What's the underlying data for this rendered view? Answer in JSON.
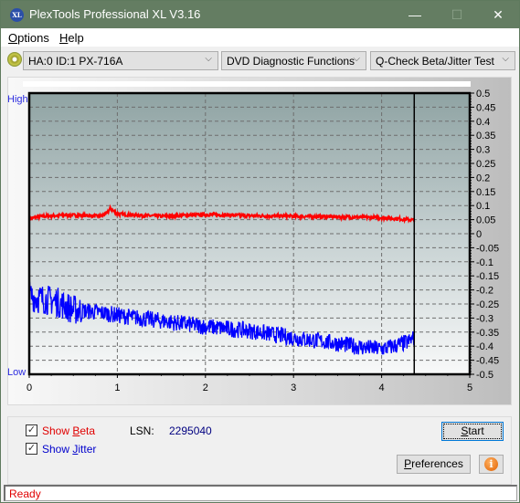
{
  "window": {
    "title": "PlexTools Professional XL V3.16",
    "app_icon": "XL",
    "minimize_icon": "—",
    "maximize_icon": "☐",
    "close_icon": "✕"
  },
  "menu": {
    "items": [
      {
        "label": "Options",
        "mnemonic": "O",
        "rest": "ptions"
      },
      {
        "label": "Help",
        "mnemonic": "H",
        "rest": "elp"
      }
    ]
  },
  "toolbar": {
    "drive_select": "HA:0 ID:1  PX-716A",
    "function_select": "DVD Diagnostic Functions",
    "test_select": "Q-Check Beta/Jitter Test",
    "chevron": "⌵"
  },
  "chart_data": {
    "type": "line",
    "title": "",
    "xlabel": "",
    "ylabel": "",
    "xlim": [
      0,
      5
    ],
    "ylim": [
      -0.5,
      0.5
    ],
    "x_ticks": [
      "0",
      "1",
      "2",
      "3",
      "4",
      "5"
    ],
    "y_ticks_right": [
      "0.5",
      "0.45",
      "0.4",
      "0.35",
      "0.3",
      "0.25",
      "0.2",
      "0.15",
      "0.1",
      "0.05",
      "0",
      "-0.05",
      "-0.1",
      "-0.15",
      "-0.2",
      "-0.25",
      "-0.3",
      "-0.35",
      "-0.4",
      "-0.45",
      "-0.5"
    ],
    "y_left_labels": {
      "top": "High",
      "bottom": "Low"
    },
    "grid": true,
    "end_marker_x": 4.37,
    "series": [
      {
        "name": "Beta",
        "color": "#ff0000",
        "noise": 0.006,
        "x": [
          0,
          0.1,
          0.2,
          0.4,
          0.6,
          0.8,
          0.88,
          0.92,
          1.0,
          1.2,
          1.5,
          2.0,
          2.5,
          3.0,
          3.5,
          4.0,
          4.2,
          4.37
        ],
        "y": [
          0.053,
          0.06,
          0.063,
          0.066,
          0.065,
          0.062,
          0.072,
          0.09,
          0.07,
          0.066,
          0.062,
          0.068,
          0.064,
          0.062,
          0.06,
          0.057,
          0.053,
          0.048
        ]
      },
      {
        "name": "Jitter",
        "color": "#0000ff",
        "noise": 0.03,
        "x": [
          0,
          0.1,
          0.3,
          0.5,
          0.8,
          1.0,
          1.5,
          2.0,
          2.5,
          3.0,
          3.5,
          3.8,
          4.0,
          4.2,
          4.3,
          4.37
        ],
        "y": [
          -0.22,
          -0.23,
          -0.24,
          -0.27,
          -0.28,
          -0.29,
          -0.31,
          -0.33,
          -0.345,
          -0.37,
          -0.39,
          -0.405,
          -0.41,
          -0.395,
          -0.385,
          -0.37
        ]
      }
    ]
  },
  "controls": {
    "show_beta": {
      "label_pre": "Show ",
      "mnemonic": "B",
      "label_post": "eta",
      "checked": true,
      "color": "#e00000"
    },
    "show_jitter": {
      "label_pre": "Show ",
      "mnemonic": "J",
      "label_post": "itter",
      "checked": true,
      "color": "#0000cc"
    },
    "lsn_label": "LSN:",
    "lsn_value": "2295040",
    "start_button": {
      "mnemonic": "S",
      "rest": "tart"
    },
    "preferences_button": {
      "mnemonic": "P",
      "rest": "references"
    },
    "info_icon": "i"
  },
  "status": {
    "text": "Ready"
  }
}
